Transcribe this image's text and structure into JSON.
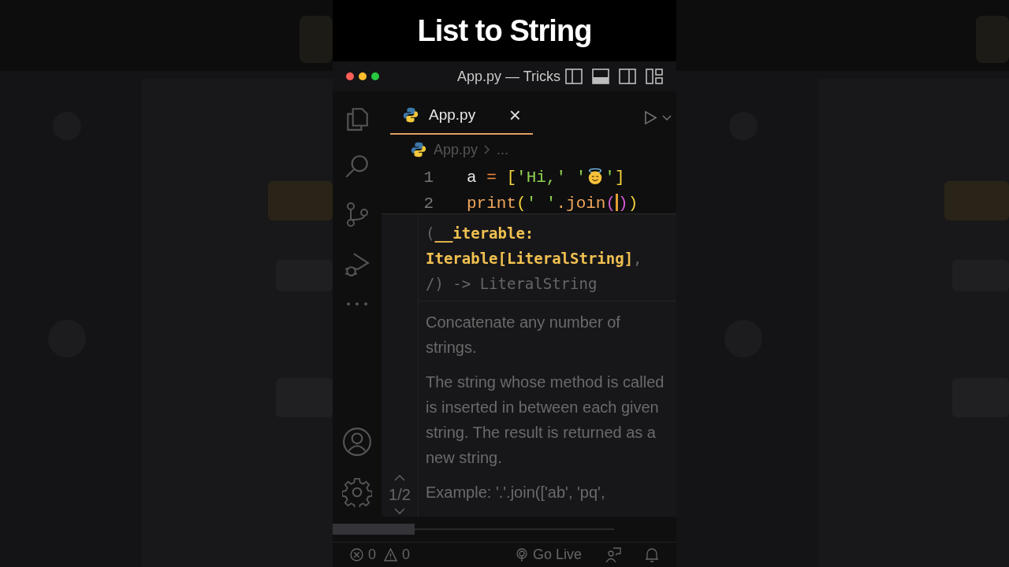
{
  "video_title": "List to String",
  "window": {
    "title": "App.py — Tricks"
  },
  "tab": {
    "label": "App.py",
    "selected": true,
    "close": "×"
  },
  "breadcrumb": {
    "file": "App.py",
    "rest": "..."
  },
  "code_lines": [
    {
      "number": "1",
      "tokens": [
        {
          "kind": "name",
          "text": "a "
        },
        {
          "kind": "operator",
          "text": "= "
        },
        {
          "kind": "bracket",
          "text": "["
        },
        {
          "kind": "string",
          "text": "'Hi,' '"
        },
        {
          "kind": "emoji"
        },
        {
          "kind": "string",
          "text": "'"
        },
        {
          "kind": "bracket",
          "text": "]"
        }
      ]
    },
    {
      "number": "2",
      "tokens": [
        {
          "kind": "function",
          "text": "print"
        },
        {
          "kind": "bracket",
          "text": "("
        },
        {
          "kind": "string",
          "text": "' '"
        },
        {
          "kind": "function",
          "text": ".join"
        },
        {
          "kind": "inner",
          "text": "("
        },
        {
          "kind": "cursor"
        },
        {
          "kind": "inner",
          "text": ")"
        },
        {
          "kind": "bracket",
          "text": ")"
        }
      ]
    }
  ],
  "hover": {
    "signature": [
      [
        {
          "text": "(",
          "active": false
        },
        {
          "text": "__iterable:",
          "active": true
        }
      ],
      [
        {
          "text": "Iterable[LiteralString]",
          "active": true
        },
        {
          "text": ",",
          "active": false
        }
      ],
      [
        {
          "text": "/) -> LiteralString",
          "active": false
        }
      ]
    ],
    "paragraphs": [
      "Concatenate any number of strings.",
      "The string whose method is called is inserted in between each given string. The result is returned as a new string.",
      "Example: '.'.join(['ab', 'pq',"
    ],
    "pager": "1/2"
  },
  "status_bar": {
    "errors": "0",
    "warnings": "0",
    "live": "Go Live"
  }
}
